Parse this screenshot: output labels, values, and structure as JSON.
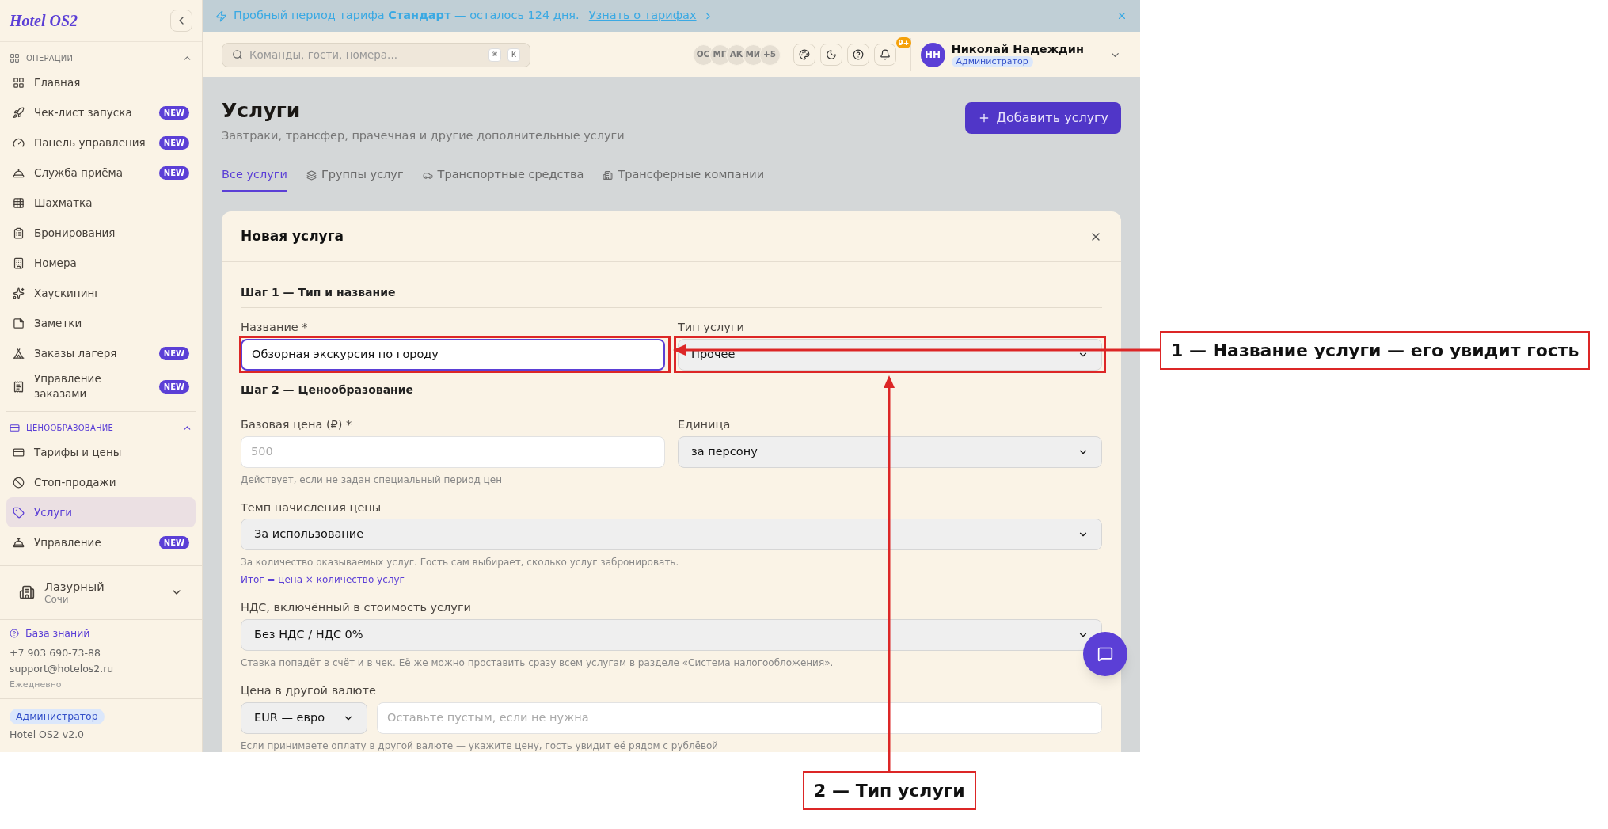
{
  "banner": {
    "text": "Пробный период тарифа **Стандарт** — осталось 124 дня.",
    "link": "Узнать о тарифах"
  },
  "sidebar": {
    "logo": "Hotel OS2",
    "sections": [
      {
        "title": "ОПЕРАЦИИ",
        "expanded": true,
        "items": [
          {
            "label": "Главная",
            "selected": false
          },
          {
            "label": "Чек-лист запуска",
            "badge": "NEW",
            "selected": false
          },
          {
            "label": "Панель управления",
            "badge": "NEW",
            "selected": false
          },
          {
            "label": "Служба приёма",
            "badge": "NEW",
            "selected": false
          },
          {
            "label": "Шахматка",
            "selected": false
          },
          {
            "label": "Бронирования",
            "selected": false
          },
          {
            "label": "Номера",
            "selected": false
          },
          {
            "label": "Хаускипинг",
            "selected": false
          },
          {
            "label": "Заметки",
            "selected": false
          },
          {
            "label": "Заказы лагеря",
            "badge": "NEW",
            "selected": false
          },
          {
            "label": "Управление заказами",
            "badge": "NEW",
            "selected": false
          }
        ]
      },
      {
        "title": "ЦЕНООБРАЗОВАНИЕ",
        "expanded": true,
        "items": [
          {
            "label": "Тарифы и цены",
            "selected": false
          },
          {
            "label": "Стоп-продажи",
            "selected": false
          },
          {
            "label": "Услуги",
            "selected": true
          },
          {
            "label": "Управление",
            "badge": "NEW",
            "selected": false
          }
        ]
      }
    ],
    "property": {
      "name": "Лазурный",
      "city": "Сочи"
    },
    "help": {
      "link": "База знаний",
      "phone": "+7 903 690-73-88",
      "email": "support@hotelos2.ru",
      "hours": "Ежедневно"
    },
    "footer": {
      "role": "Администратор",
      "version": "Hotel OS2 v2.0"
    }
  },
  "topbar": {
    "search_placeholder": "Команды, гости, номера...",
    "keys": [
      "⌘",
      "K"
    ],
    "avatars": [
      "ОС",
      "МГ",
      "АК",
      "МИ",
      "+5"
    ],
    "notification_count": "9+",
    "user": {
      "initials": "НН",
      "name": "Николай Надеждин",
      "role": "Администратор"
    }
  },
  "page": {
    "title": "Услуги",
    "subtitle": "Завтраки, трансфер, прачечная и другие дополнительные услуги",
    "add_button": "Добавить услугу",
    "tabs": [
      {
        "label": "Все услуги",
        "selected": true
      },
      {
        "label": "Группы услуг",
        "selected": false
      },
      {
        "label": "Транспортные средства",
        "selected": false
      },
      {
        "label": "Трансферные компании",
        "selected": false
      }
    ]
  },
  "form": {
    "title": "Новая услуга",
    "steps": [
      {
        "title": "Шаг 1 — Тип и название",
        "rows": [
          [
            {
              "kind": "text",
              "label": "Название *",
              "value": "Обзорная экскурсия по городу",
              "focused": true
            },
            {
              "kind": "select",
              "label": "Тип услуги",
              "value": "Прочее"
            }
          ]
        ]
      },
      {
        "title": "Шаг 2 — Ценообразование",
        "rows": [
          [
            {
              "kind": "text",
              "label": "Базовая цена (₽) *",
              "placeholder": "500",
              "focused": false,
              "hint": "Действует, если не задан специальный период цен"
            },
            {
              "kind": "select",
              "label": "Единица",
              "value": "за персону"
            }
          ],
          [
            {
              "kind": "select",
              "label": "Темп начисления цены",
              "value": "За использование",
              "hint": "За количество оказываемых услуг. Гость сам выбирает, сколько услуг забронировать.",
              "formula": "Итог = цена × количество услуг"
            }
          ],
          [
            {
              "kind": "select",
              "label": "НДС, включённый в стоимость услуги",
              "value": "Без НДС / НДС 0%",
              "hint": "Ставка попадёт в счёт и в чек. Её же можно проставить сразу всем услугам в разделе «Система налогообложения»."
            }
          ],
          [
            {
              "kind": "currency",
              "label": "Цена в другой валюте",
              "value": "EUR — евро",
              "placeholder": "Оставьте пустым, если не нужна",
              "hint": "Если принимаете оплату в другой валюте — укажите цену, гость увидит её рядом с рублёвой"
            }
          ]
        ]
      }
    ]
  },
  "annotations": [
    {
      "text": "1 — Название услуги — его увидит гость"
    },
    {
      "text": "2 — Тип услуги"
    }
  ]
}
